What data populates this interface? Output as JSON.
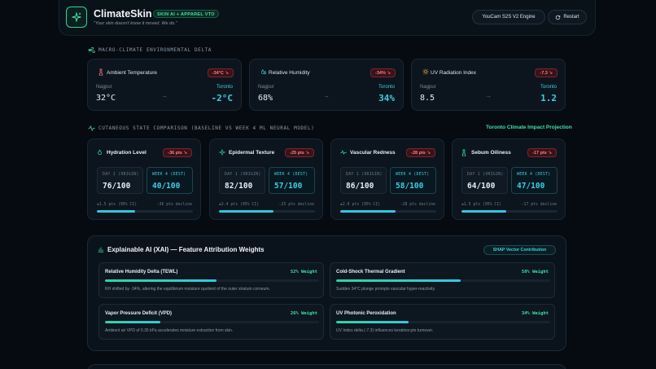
{
  "header": {
    "brand": "ClimateSkin",
    "badge": "SKIN AI + APPAREL VTO",
    "tagline": "\"Your skin doesn't know it moved. We do.\"",
    "engine_label": "YouCam S2S V2 Engine",
    "restart_label": "Restart"
  },
  "macro": {
    "section_title": "MACRO-CLIMATE ENVIRONMENTAL DELTA",
    "cards": [
      {
        "title": "Ambient Temperature",
        "delta": "-34°C ↘",
        "from_label": "Nagpur",
        "from_value": "32°C",
        "to_label": "Toronto",
        "to_value": "-2°C",
        "icon": "thermometer-icon"
      },
      {
        "title": "Relative Humidity",
        "delta": "-34% ↘",
        "from_label": "Nagpur",
        "from_value": "68%",
        "to_label": "Toronto",
        "to_value": "34%",
        "icon": "humidity-icon"
      },
      {
        "title": "UV Radiation Index",
        "delta": "-7.3 ↘",
        "from_label": "Nagpur",
        "from_value": "8.5",
        "to_label": "Toronto",
        "to_value": "1.2",
        "icon": "sun-icon"
      }
    ]
  },
  "state": {
    "section_title": "CUTANEOUS STATE COMPARISON (BASELINE VS WEEK 4 ML NEURAL MODEL)",
    "projection_link": "Toronto Climate Impact Projection",
    "origin_label": "DAY 1 (ORIGIN)",
    "dest_label": "WEEK 4 (DEST)",
    "cards": [
      {
        "title": "Hydration Level",
        "delta": "-36 pts ↘",
        "origin": "76/100",
        "dest": "40/100",
        "ci": "±1.5 pts (95% CI)",
        "decline": "-36 pts decline",
        "fill": 0.4,
        "icon": "drop-icon"
      },
      {
        "title": "Epidermal Texture",
        "delta": "-25 pts ↘",
        "origin": "82/100",
        "dest": "57/100",
        "ci": "±2.4 pts (95% CI)",
        "decline": "-25 pts decline",
        "fill": 0.57,
        "icon": "sparkle-icon"
      },
      {
        "title": "Vascular Redness",
        "delta": "-28 pts ↘",
        "origin": "86/100",
        "dest": "58/100",
        "ci": "±2.0 pts (95% CI)",
        "decline": "-28 pts decline",
        "fill": 0.58,
        "icon": "pulse-icon"
      },
      {
        "title": "Sebum Oiliness",
        "delta": "-17 pts ↘",
        "origin": "64/100",
        "dest": "47/100",
        "ci": "±1.5 pts (95% CI)",
        "decline": "-17 pts decline",
        "fill": 0.47,
        "icon": "thermometer-icon"
      }
    ]
  },
  "xai": {
    "title": "Explainable AI (XAI) — Feature Attribution Weights",
    "shap_label": "SHAP Vector Contribution",
    "features": [
      {
        "title": "Relative Humidity Delta (TEWL)",
        "weight": "52% Weight",
        "fill": 0.52,
        "desc": "RH shifted by -34%, altering the equilibrium moisture quotient of the outer stratum corneum."
      },
      {
        "title": "Cold-Shock Thermal Gradient",
        "weight": "58% Weight",
        "fill": 0.58,
        "desc": "Sudden 34°C plunge prompts vascular hyper-reactivity."
      },
      {
        "title": "Vapor Pressure Deficit (VPD)",
        "weight": "26% Weight",
        "fill": 0.26,
        "desc": "Ambient air VPD of 0.35 kPa accelerates moisture extraction from skin."
      },
      {
        "title": "UV Photonic Peroxidation",
        "weight": "34% Weight",
        "fill": 0.34,
        "desc": "UV Index delta (-7.3) influences keratinocyte turnover."
      }
    ]
  },
  "colors": {
    "accent_green": "#3ee0a6",
    "accent_cyan": "#3ccfe0",
    "delta_red": "#ff7b8a",
    "background": "#060b11"
  }
}
